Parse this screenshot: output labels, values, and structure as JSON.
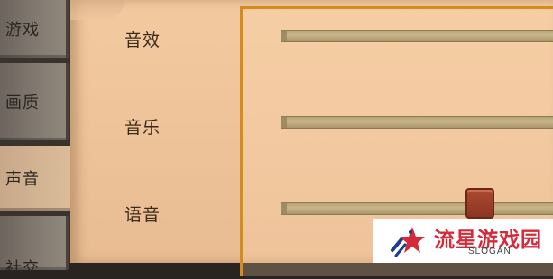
{
  "tabs": [
    {
      "label": "游戏"
    },
    {
      "label": "画质"
    },
    {
      "label": "声音",
      "active": true
    },
    {
      "label": "社交"
    }
  ],
  "settings": {
    "sound_effects": {
      "label": "音效",
      "level": null
    },
    "music": {
      "label": "音乐",
      "level": null
    },
    "voice": {
      "label": "语音",
      "level": 0.73
    }
  },
  "watermark": {
    "title": "流星游戏园",
    "slogan": "SLOGAN",
    "logo_icon": "shooting-star-icon"
  },
  "colors": {
    "parchment": "#f0c59c",
    "frame_accent": "#d58b1e",
    "slider_track": "#b9a679",
    "knob": "#9e3f2a",
    "watermark_red": "#d42a3a"
  }
}
